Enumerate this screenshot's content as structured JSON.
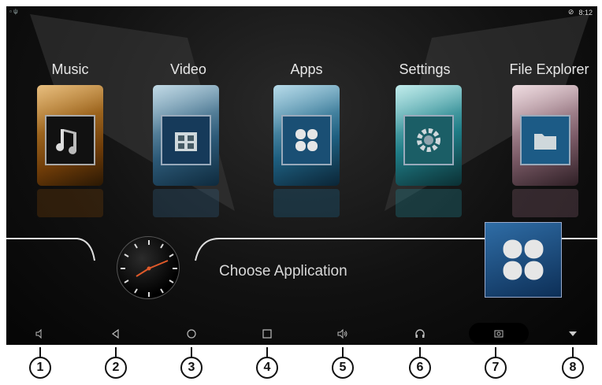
{
  "status_bar": {
    "time": "8:12"
  },
  "apps": [
    {
      "label": "Music",
      "icon": "music-notes-icon",
      "color": "#c17b1a"
    },
    {
      "label": "Video",
      "icon": "film-icon",
      "color": "#3c6e8f"
    },
    {
      "label": "Apps",
      "icon": "four-petal-icon",
      "color": "#2e6f8f"
    },
    {
      "label": "Settings",
      "icon": "gear-icon",
      "color": "#2b7d86"
    },
    {
      "label": "File Explorer",
      "icon": "folder-icon",
      "color": "#8b6f7a"
    }
  ],
  "home": {
    "choose_label": "Choose Application",
    "selected_icon": "four-petal-icon"
  },
  "navbar": [
    {
      "name": "volume-down-icon"
    },
    {
      "name": "back-icon"
    },
    {
      "name": "home-icon"
    },
    {
      "name": "recent-apps-icon"
    },
    {
      "name": "volume-up-icon"
    },
    {
      "name": "headphones-icon"
    },
    {
      "name": "screenshot-icon"
    },
    {
      "name": "dropdown-arrow-icon"
    }
  ],
  "callouts": [
    "1",
    "2",
    "3",
    "4",
    "5",
    "6",
    "7",
    "8"
  ]
}
